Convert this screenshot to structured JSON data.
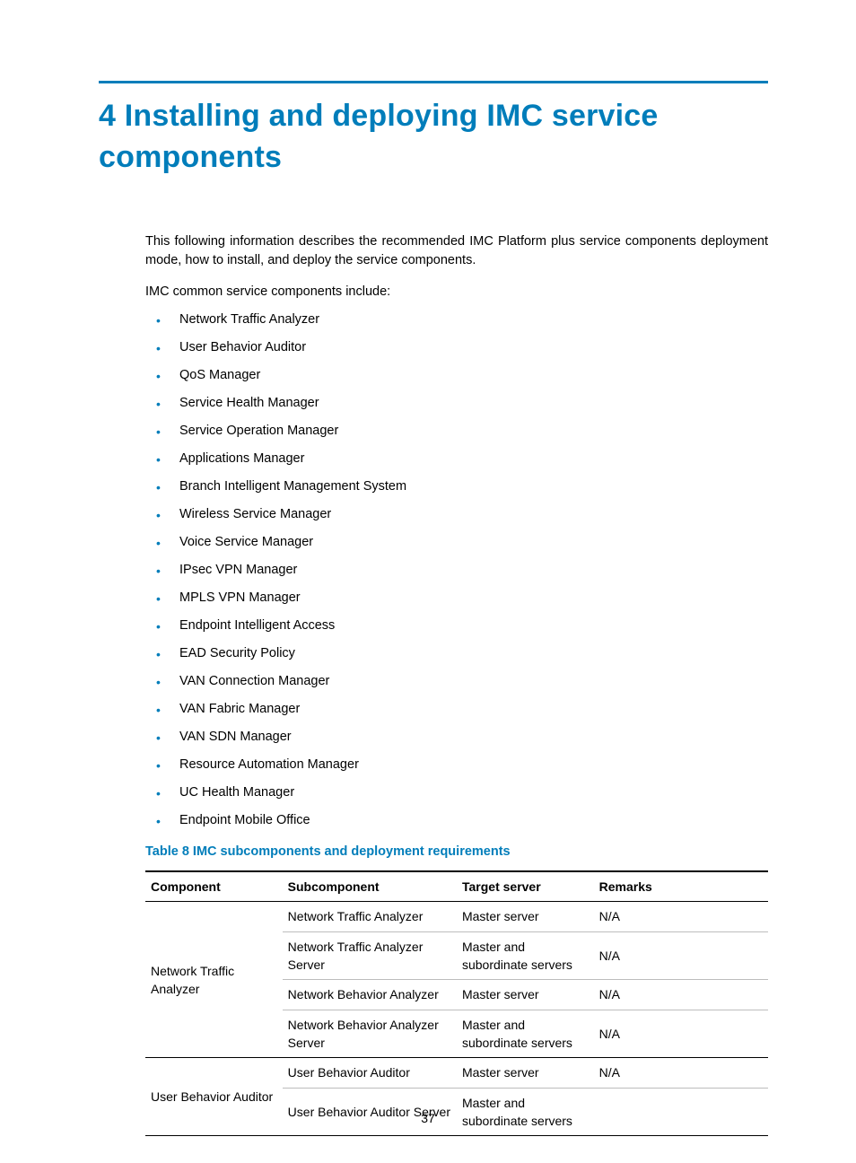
{
  "chapter": {
    "title": "4 Installing and deploying IMC service components"
  },
  "intro": {
    "p1": "This following information describes the recommended IMC Platform plus service components deployment mode, how to install, and deploy the service components.",
    "p2": "IMC common service components include:"
  },
  "components": [
    "Network Traffic Analyzer",
    "User Behavior Auditor",
    "QoS Manager",
    "Service Health Manager",
    "Service Operation Manager",
    "Applications Manager",
    "Branch Intelligent Management System",
    "Wireless Service Manager",
    "Voice Service Manager",
    "IPsec VPN Manager",
    "MPLS VPN Manager",
    "Endpoint Intelligent Access",
    "EAD Security Policy",
    "VAN Connection Manager",
    "VAN Fabric Manager",
    "VAN SDN Manager",
    "Resource Automation Manager",
    "UC Health Manager",
    "Endpoint Mobile Office"
  ],
  "table": {
    "caption": "Table 8 IMC subcomponents and deployment requirements",
    "headers": {
      "component": "Component",
      "subcomponent": "Subcomponent",
      "target": "Target server",
      "remarks": "Remarks"
    },
    "groups": [
      {
        "component": "Network Traffic Analyzer",
        "rows": [
          {
            "sub": "Network Traffic Analyzer",
            "target": "Master server",
            "remarks": "N/A"
          },
          {
            "sub": "Network Traffic Analyzer Server",
            "target": "Master and subordinate servers",
            "remarks": "N/A"
          },
          {
            "sub": "Network Behavior Analyzer",
            "target": "Master server",
            "remarks": "N/A"
          },
          {
            "sub": "Network Behavior Analyzer Server",
            "target": "Master and subordinate servers",
            "remarks": "N/A"
          }
        ]
      },
      {
        "component": "User Behavior Auditor",
        "rows": [
          {
            "sub": "User Behavior Auditor",
            "target": "Master server",
            "remarks": "N/A"
          },
          {
            "sub": "User Behavior Auditor Server",
            "target": "Master and subordinate servers",
            "remarks": ""
          }
        ]
      }
    ]
  },
  "page_number": "37"
}
